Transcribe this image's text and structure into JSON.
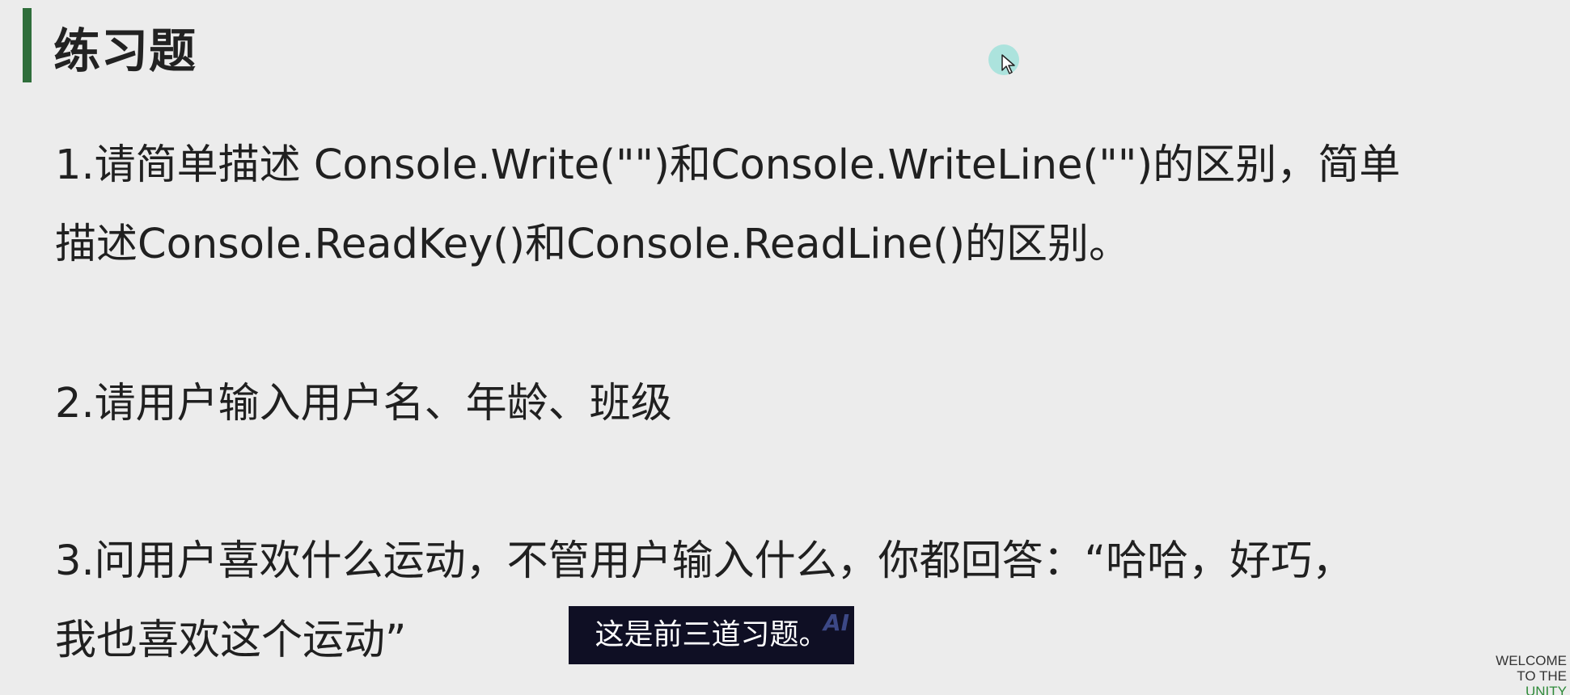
{
  "slide": {
    "title": "练习题",
    "questions": [
      {
        "lines": [
          "1.请简单描述 Console.Write(\"\")和Console.WriteLine(\"\")的区别，简单",
          "描述Console.ReadKey()和Console.ReadLine()的区别。"
        ]
      },
      {
        "lines": [
          "2.请用户输入用户名、年龄、班级"
        ]
      },
      {
        "lines": [
          "3.问用户喜欢什么运动，不管用户输入什么，你都回答：“哈哈，好巧，",
          "我也喜欢这个运动”"
        ]
      }
    ]
  },
  "subtitle": {
    "text": "这是前三道习题。",
    "badge": "AI"
  },
  "watermark": {
    "line1": "WELCOME",
    "line2": "TO THE",
    "line3": "UNITY"
  },
  "colors": {
    "background": "#ececec",
    "title_bar": "#2f6e3b",
    "subtitle_bg": "#0f0f24"
  }
}
